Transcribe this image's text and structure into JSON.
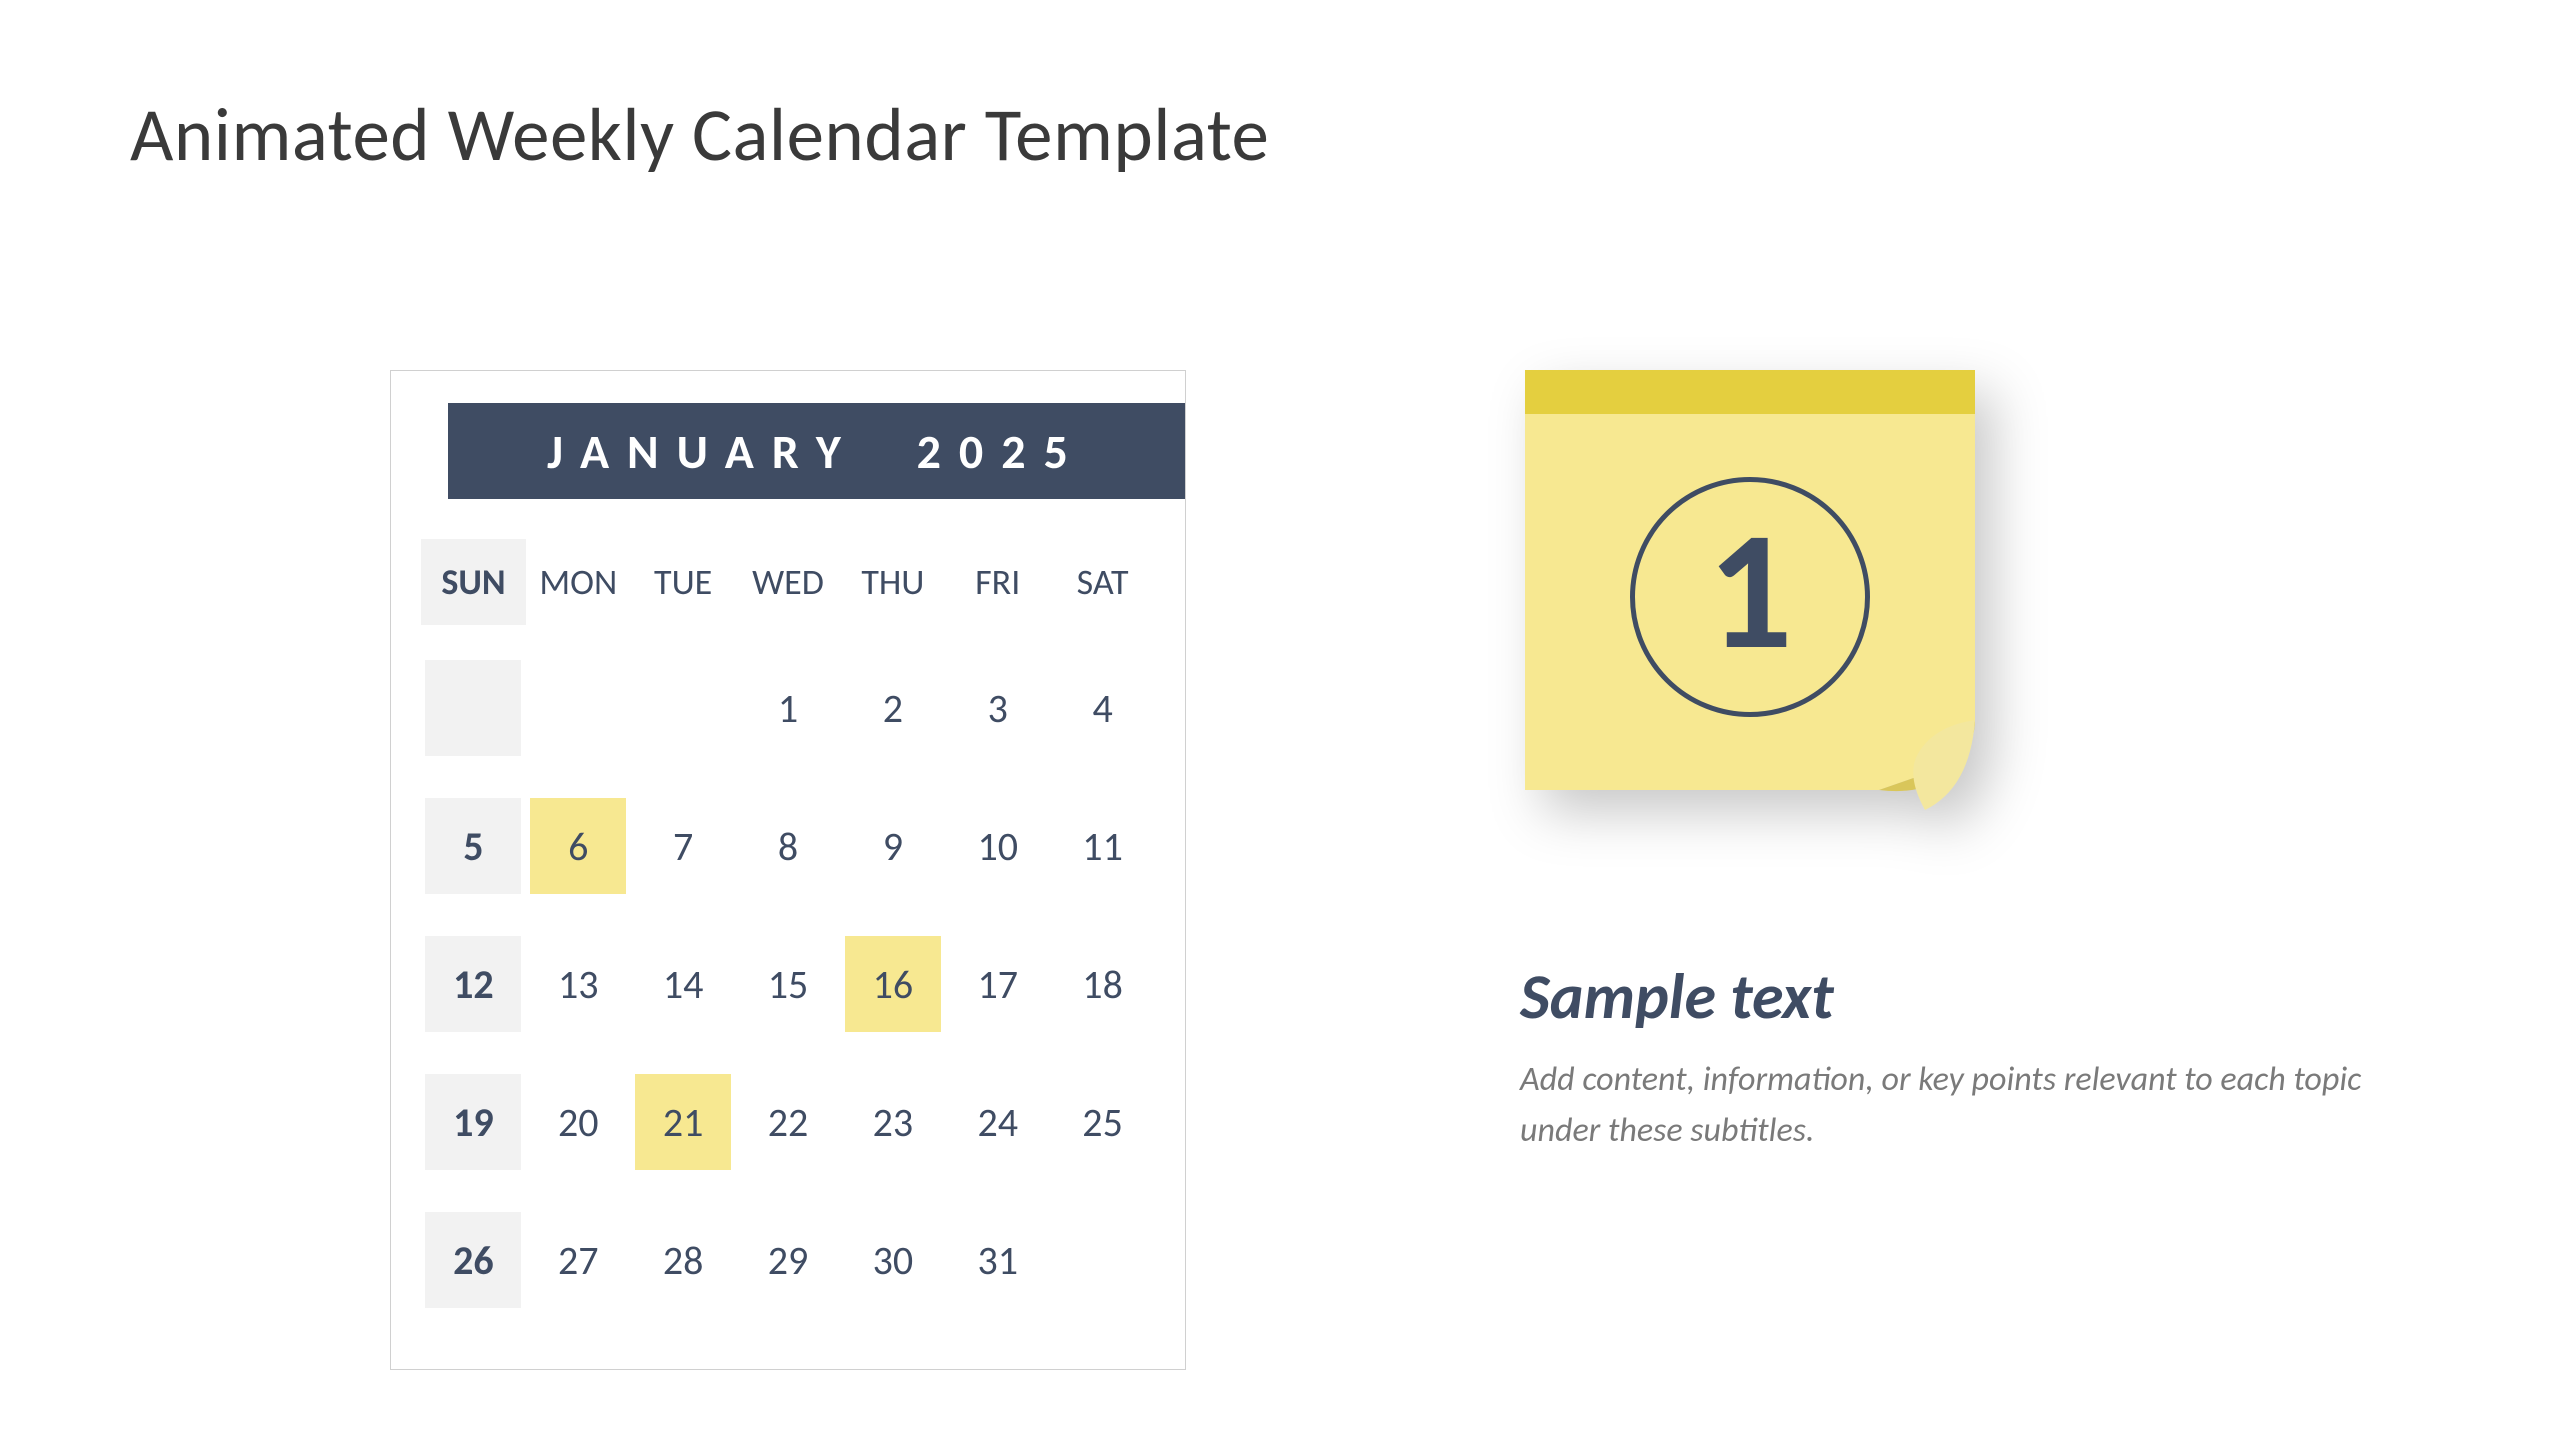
{
  "title": "Animated Weekly Calendar Template",
  "calendar": {
    "month_label": "JANUARY",
    "year": "2025",
    "dow": [
      "SUN",
      "MON",
      "TUE",
      "WED",
      "THU",
      "FRI",
      "SAT"
    ],
    "weeks": [
      [
        "",
        "",
        "",
        "1",
        "2",
        "3",
        "4"
      ],
      [
        "5",
        "6",
        "7",
        "8",
        "9",
        "10",
        "11"
      ],
      [
        "12",
        "13",
        "14",
        "15",
        "16",
        "17",
        "18"
      ],
      [
        "19",
        "20",
        "21",
        "22",
        "23",
        "24",
        "25"
      ],
      [
        "26",
        "27",
        "28",
        "29",
        "30",
        "31",
        ""
      ]
    ],
    "highlighted_days": [
      "6",
      "16",
      "21"
    ]
  },
  "sticky": {
    "number": "1",
    "heading": "Sample text",
    "description": "Add content, information, or key points relevant to each topic under these subtitles."
  },
  "colors": {
    "navy": "#3f4c63",
    "yellow_note": "#f7e891",
    "yellow_dark": "#e4cf3f"
  }
}
